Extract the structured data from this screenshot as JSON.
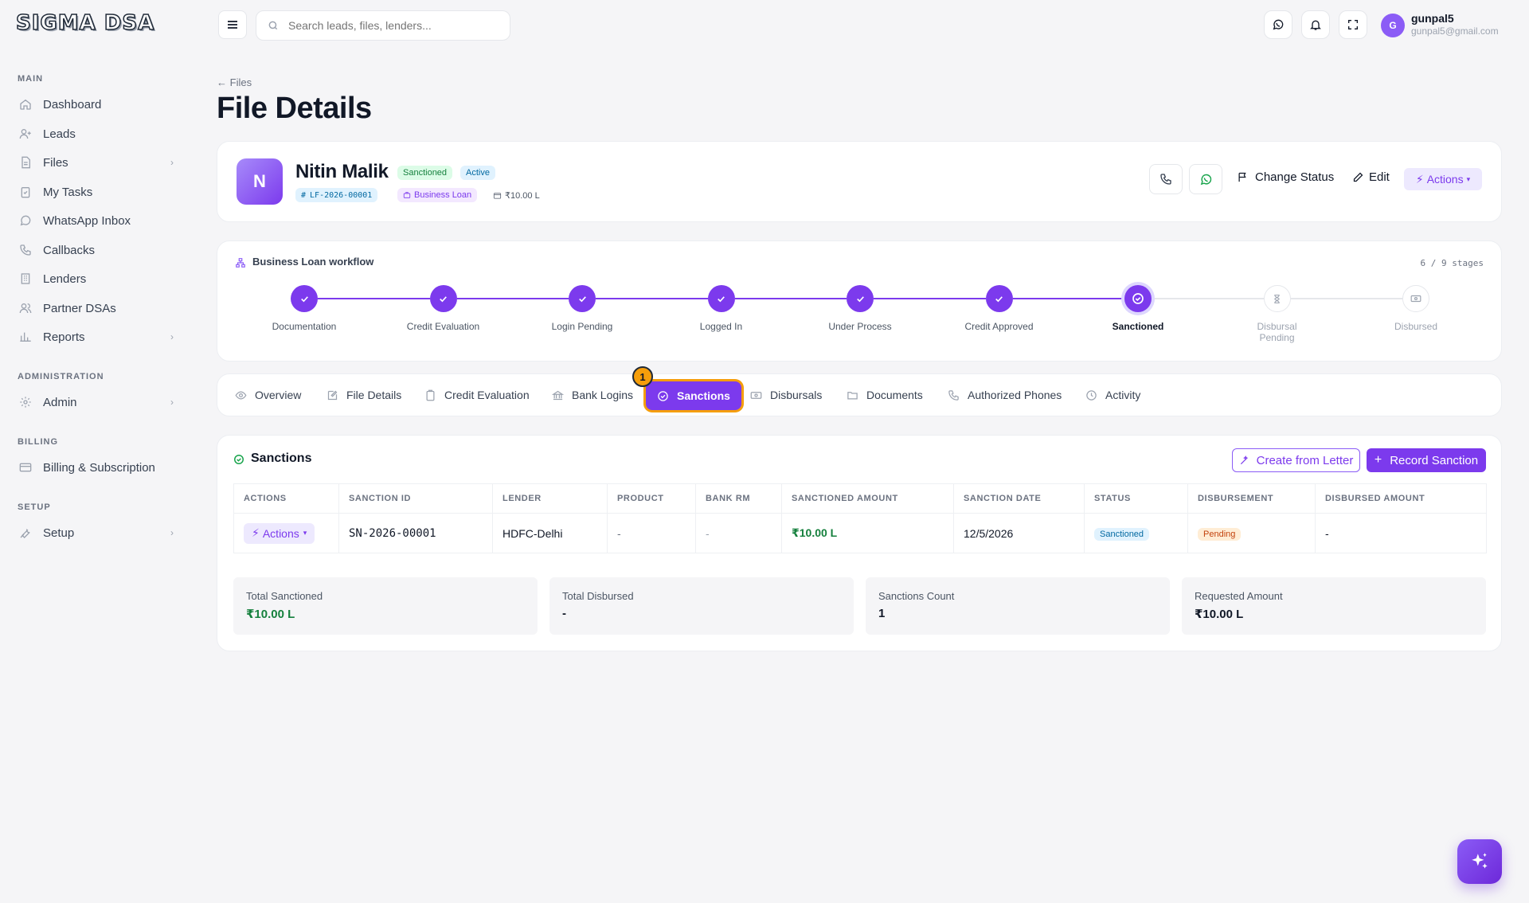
{
  "brand": {
    "logo": "SIGMA DSA"
  },
  "sidebar": {
    "sections": [
      {
        "label": "MAIN"
      },
      {
        "label": "ADMINISTRATION"
      },
      {
        "label": "BILLING"
      },
      {
        "label": "SETUP"
      }
    ],
    "items": [
      {
        "label": "Dashboard",
        "icon": "home-icon"
      },
      {
        "label": "Leads",
        "icon": "user-plus-icon"
      },
      {
        "label": "Files",
        "icon": "file-icon",
        "has_children": true
      },
      {
        "label": "My Tasks",
        "icon": "clipboard-check-icon"
      },
      {
        "label": "WhatsApp Inbox",
        "icon": "whatsapp-icon"
      },
      {
        "label": "Callbacks",
        "icon": "phone-icon"
      },
      {
        "label": "Lenders",
        "icon": "building-icon"
      },
      {
        "label": "Partner DSAs",
        "icon": "users-icon"
      },
      {
        "label": "Reports",
        "icon": "bar-chart-icon",
        "has_children": true
      },
      {
        "label": "Admin",
        "icon": "gear-icon",
        "has_children": true
      },
      {
        "label": "Billing & Subscription",
        "icon": "credit-card-icon"
      },
      {
        "label": "Setup",
        "icon": "wrench-icon",
        "has_children": true
      }
    ]
  },
  "topbar": {
    "search_placeholder": "Search leads, files, lenders...",
    "user": {
      "initial": "G",
      "name": "gunpal5",
      "email": "gunpal5@gmail.com"
    }
  },
  "breadcrumb": {
    "back_label": "Files"
  },
  "page": {
    "title": "File Details"
  },
  "client": {
    "initial": "N",
    "name": "Nitin Malik",
    "status_badge": "Sanctioned",
    "state_badge": "Active",
    "file_id": "LF-2026-00001",
    "product": "Business Loan",
    "amount": "₹10.00 L",
    "change_status_label": "Change Status",
    "edit_label": "Edit",
    "actions_label": "Actions"
  },
  "workflow": {
    "title": "Business Loan workflow",
    "count": "6 / 9 stages",
    "stages": [
      {
        "label": "Documentation",
        "state": "done"
      },
      {
        "label": "Credit Evaluation",
        "state": "done"
      },
      {
        "label": "Login Pending",
        "state": "done"
      },
      {
        "label": "Logged In",
        "state": "done"
      },
      {
        "label": "Under Process",
        "state": "done"
      },
      {
        "label": "Credit Approved",
        "state": "done"
      },
      {
        "label": "Sanctioned",
        "state": "current"
      },
      {
        "label": "Disbursal Pending",
        "state": "pending"
      },
      {
        "label": "Disbursed",
        "state": "pending"
      }
    ]
  },
  "tabs": [
    {
      "label": "Overview"
    },
    {
      "label": "File Details"
    },
    {
      "label": "Credit Evaluation"
    },
    {
      "label": "Bank Logins"
    },
    {
      "label": "Sanctions",
      "active": true
    },
    {
      "label": "Disbursals"
    },
    {
      "label": "Documents"
    },
    {
      "label": "Authorized Phones"
    },
    {
      "label": "Activity"
    }
  ],
  "step_marker": "1",
  "sanctions": {
    "title": "Sanctions",
    "create_from_letter_label": "Create from Letter",
    "record_sanction_label": "Record Sanction",
    "columns": [
      "ACTIONS",
      "SANCTION ID",
      "LENDER",
      "PRODUCT",
      "BANK RM",
      "SANCTIONED AMOUNT",
      "SANCTION DATE",
      "STATUS",
      "DISBURSEMENT",
      "DISBURSED AMOUNT"
    ],
    "rows": [
      {
        "actions_label": "Actions",
        "sanction_id": "SN-2026-00001",
        "lender": "HDFC-Delhi",
        "product": "-",
        "bank_rm": "-",
        "sanctioned_amount": "₹10.00 L",
        "sanction_date": "12/5/2026",
        "status": "Sanctioned",
        "disbursement": "Pending",
        "disbursed_amount": "-"
      }
    ],
    "stats": [
      {
        "label": "Total Sanctioned",
        "value": "₹10.00 L"
      },
      {
        "label": "Total Disbursed",
        "value": "-"
      },
      {
        "label": "Sanctions Count",
        "value": "1"
      },
      {
        "label": "Requested Amount",
        "value": "₹10.00 L"
      }
    ]
  },
  "colors": {
    "accent": "#7c3aed",
    "success": "#15803d",
    "highlight": "#f59e0b"
  }
}
